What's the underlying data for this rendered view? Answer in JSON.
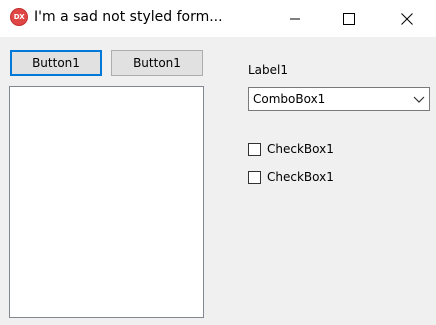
{
  "window": {
    "app_icon_text": "DX",
    "title": "I'm a sad not styled form..."
  },
  "controls": {
    "button1_label": "Button1",
    "button2_label": "Button1",
    "label1": "Label1",
    "combobox": {
      "value": "ComboBox1"
    },
    "checkboxes": [
      {
        "label": "CheckBox1",
        "checked": false
      },
      {
        "label": "CheckBox1",
        "checked": false
      }
    ]
  },
  "colors": {
    "focus_border": "#0078d7",
    "app_icon": "#e04646"
  },
  "icons": [
    "app-logo-icon",
    "minimize-icon",
    "maximize-icon",
    "close-icon",
    "chevron-down-icon"
  ]
}
